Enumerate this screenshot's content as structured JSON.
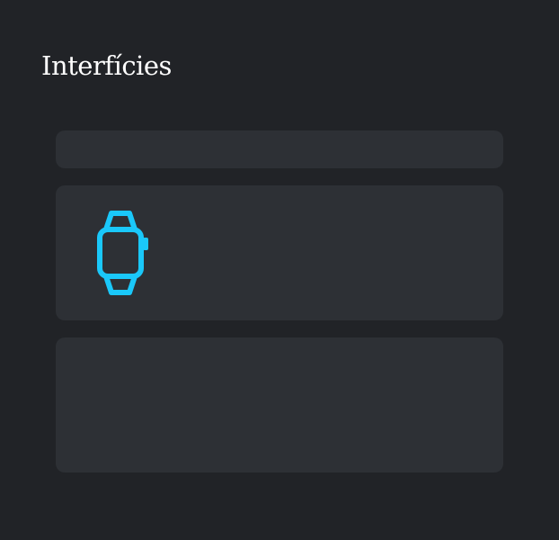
{
  "page": {
    "title": "Interfícies"
  },
  "cards": [
    {
      "icon": null
    },
    {
      "icon": "smartwatch-icon"
    },
    {
      "icon": null
    }
  ],
  "colors": {
    "background": "#212327",
    "card": "#2d3035",
    "accent": "#1ac8fa",
    "title": "#ffffff"
  }
}
